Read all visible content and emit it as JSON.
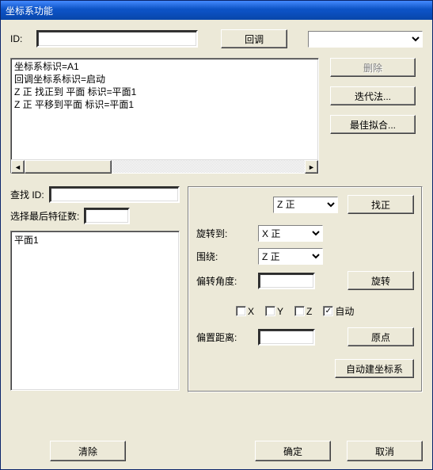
{
  "window": {
    "title": "坐标系功能"
  },
  "top": {
    "id_label": "ID:",
    "id_value": "",
    "recall_button": "回调",
    "combo_value": ""
  },
  "log_lines": "坐标系标识=A1\n回调坐标系标识=启动\nZ 正 找正到 平面 标识=平面1\nZ 正 平移到平面 标识=平面1",
  "right_buttons": {
    "delete": "删除",
    "iterate": "迭代法...",
    "bestfit": "最佳拟合..."
  },
  "left": {
    "find_id_label": "查找 ID:",
    "find_id_value": "",
    "last_feat_label": "选择最后特征数:",
    "last_feat_value": "",
    "list_item0": "平面1"
  },
  "right_panel": {
    "axis1_combo": "Z 正",
    "level_button": "找正",
    "rotate_to_label": "旋转到:",
    "rotate_to_combo": "X 正",
    "about_label": "围绕:",
    "about_combo": "Z 正",
    "offset_angle_label": "偏转角度:",
    "offset_angle_value": "",
    "rotate_button": "旋转",
    "cb_x": "X",
    "cb_y": "Y",
    "cb_z": "Z",
    "cb_auto": "自动",
    "auto_checked": true,
    "offset_dist_label": "偏置距离:",
    "offset_dist_value": "",
    "origin_button": "原点",
    "autocs_button": "自动建坐标系"
  },
  "bottom": {
    "clear": "清除",
    "ok": "确定",
    "cancel": "取消"
  }
}
